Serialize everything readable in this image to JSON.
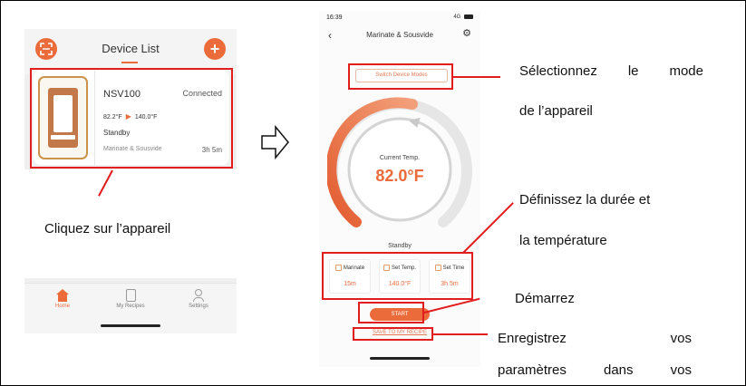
{
  "left_phone": {
    "title": "Device List",
    "scan_icon": "scan-icon",
    "add_icon": "plus-icon",
    "device": {
      "name": "NSV100",
      "status": "Connected",
      "current_temp": "82.2°F",
      "target_temp": "140.0°F",
      "state": "Standby",
      "mode": "Marinate & Sousvide",
      "time": "3h 5m"
    },
    "nav": [
      {
        "label": "Home",
        "icon": "home-icon"
      },
      {
        "label": "My Recipes",
        "icon": "recipes-icon"
      },
      {
        "label": "Settings",
        "icon": "settings-icon"
      }
    ]
  },
  "right_phone": {
    "status_time": "16:39",
    "status_right": "4G",
    "title": "Marinate & Sousvide",
    "switch_mode_label": "Switch Device Modes",
    "current_temp_label": "Current Temp.",
    "current_temp": "82.0°F",
    "state": "Standby",
    "settings": [
      {
        "label": "Marinate",
        "value": "15m"
      },
      {
        "label": "Set Temp.",
        "value": "140.0°F"
      },
      {
        "label": "Set Time",
        "value": "3h 5m"
      }
    ],
    "start_label": "START",
    "save_label": "SAVE TO MY RECIPE"
  },
  "annotations": {
    "click_device": "Cliquez sur l’appareil",
    "select_mode_line1": [
      "Sélectionnez",
      "le",
      "mode"
    ],
    "select_mode_line2": "de l’appareil",
    "set_duration_line1": "Définissez la durée et",
    "set_duration_line2": "la température",
    "start": "Démarrez",
    "save_line1": [
      "Enregistrez",
      "vos"
    ],
    "save_line2": [
      "paramètres",
      "dans",
      "vos"
    ]
  },
  "colors": {
    "accent": "#ec6b3b",
    "annotation": "#e11d1d"
  }
}
